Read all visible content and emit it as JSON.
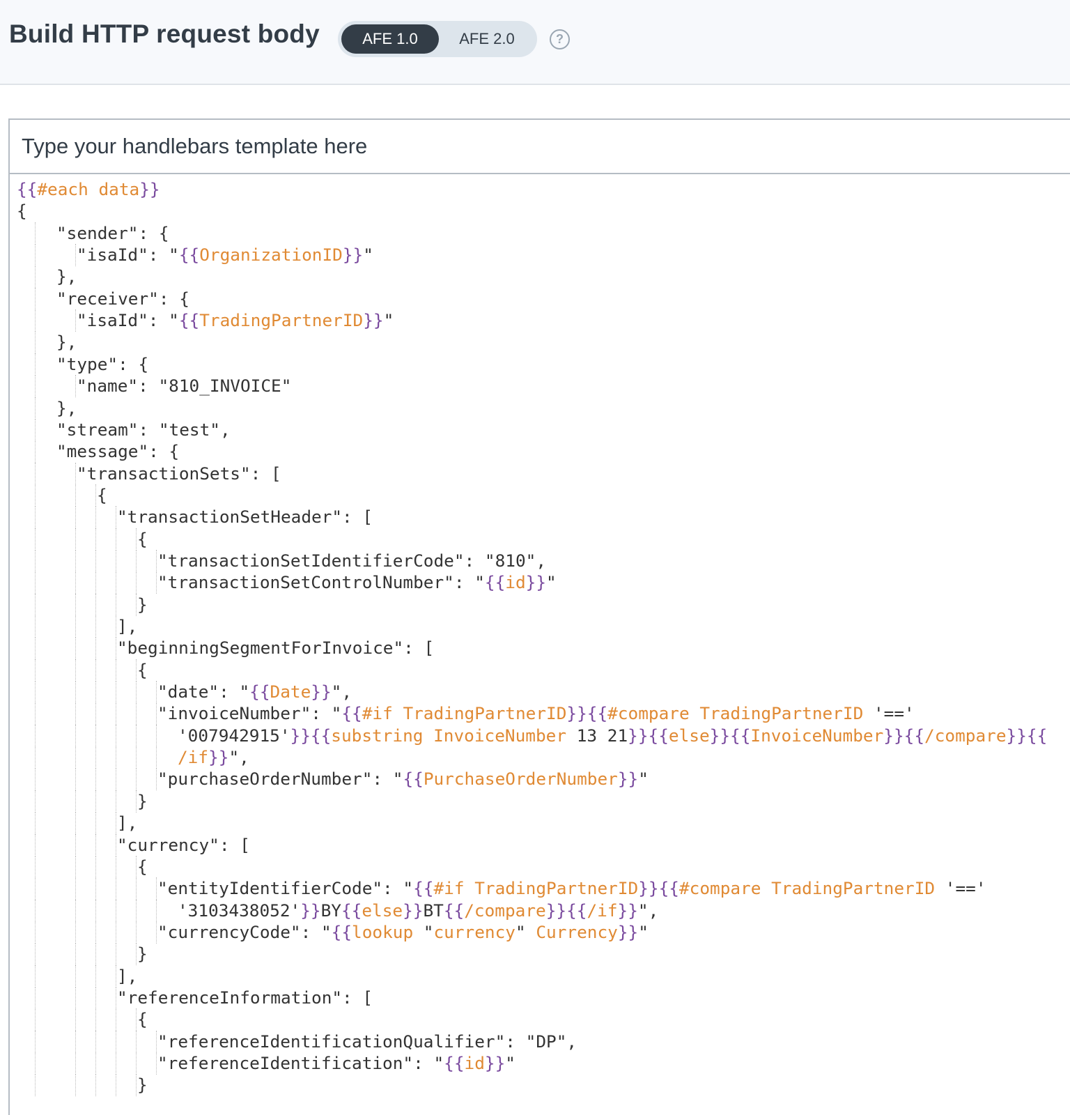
{
  "header": {
    "title": "Build HTTP request body",
    "toggle_options": [
      "AFE 1.0",
      "AFE 2.0"
    ],
    "active_option": "AFE 1.0",
    "help_icon_glyph": "?"
  },
  "editor": {
    "placeholder": "Type your handlebars template here",
    "colors": {
      "handlebars_brace": "#7a4a9e",
      "handlebars_keyword": "#e08a34",
      "text": "#333333"
    },
    "lines": [
      {
        "indent": 0,
        "tokens": [
          [
            "h",
            "{{"
          ],
          [
            "k",
            "#each data"
          ],
          [
            "h",
            "}}"
          ]
        ]
      },
      {
        "indent": 0,
        "tokens": [
          [
            "t",
            "{"
          ]
        ]
      },
      {
        "indent": 1,
        "tokens": [
          [
            "t",
            "\"sender\": {"
          ]
        ]
      },
      {
        "indent": 2,
        "tokens": [
          [
            "t",
            "\"isaId\": \""
          ],
          [
            "h",
            "{{"
          ],
          [
            "k",
            "OrganizationID"
          ],
          [
            "h",
            "}}"
          ],
          [
            "t",
            "\""
          ]
        ]
      },
      {
        "indent": 1,
        "tokens": [
          [
            "t",
            "},"
          ]
        ]
      },
      {
        "indent": 1,
        "tokens": [
          [
            "t",
            "\"receiver\": {"
          ]
        ]
      },
      {
        "indent": 2,
        "tokens": [
          [
            "t",
            "\"isaId\": \""
          ],
          [
            "h",
            "{{"
          ],
          [
            "k",
            "TradingPartnerID"
          ],
          [
            "h",
            "}}"
          ],
          [
            "t",
            "\""
          ]
        ]
      },
      {
        "indent": 1,
        "tokens": [
          [
            "t",
            "},"
          ]
        ]
      },
      {
        "indent": 1,
        "tokens": [
          [
            "t",
            "\"type\": {"
          ]
        ]
      },
      {
        "indent": 2,
        "tokens": [
          [
            "t",
            "\"name\": \"810_INVOICE\""
          ]
        ]
      },
      {
        "indent": 1,
        "tokens": [
          [
            "t",
            "},"
          ]
        ]
      },
      {
        "indent": 1,
        "tokens": [
          [
            "t",
            "\"stream\": \"test\","
          ]
        ]
      },
      {
        "indent": 1,
        "tokens": [
          [
            "t",
            "\"message\": {"
          ]
        ]
      },
      {
        "indent": 2,
        "tokens": [
          [
            "t",
            "\"transactionSets\": ["
          ]
        ]
      },
      {
        "indent": 3,
        "tokens": [
          [
            "t",
            "{"
          ]
        ]
      },
      {
        "indent": 4,
        "tokens": [
          [
            "t",
            "\"transactionSetHeader\": ["
          ]
        ]
      },
      {
        "indent": 5,
        "tokens": [
          [
            "t",
            "{"
          ]
        ]
      },
      {
        "indent": 6,
        "tokens": [
          [
            "t",
            "\"transactionSetIdentifierCode\": \"810\","
          ]
        ]
      },
      {
        "indent": 6,
        "tokens": [
          [
            "t",
            "\"transactionSetControlNumber\": \""
          ],
          [
            "h",
            "{{"
          ],
          [
            "k",
            "id"
          ],
          [
            "h",
            "}}"
          ],
          [
            "t",
            "\""
          ]
        ]
      },
      {
        "indent": 5,
        "tokens": [
          [
            "t",
            "}"
          ]
        ]
      },
      {
        "indent": 4,
        "tokens": [
          [
            "t",
            "],"
          ]
        ]
      },
      {
        "indent": 4,
        "tokens": [
          [
            "t",
            "\"beginningSegmentForInvoice\": ["
          ]
        ]
      },
      {
        "indent": 5,
        "tokens": [
          [
            "t",
            "{"
          ]
        ]
      },
      {
        "indent": 6,
        "tokens": [
          [
            "t",
            "\"date\": \""
          ],
          [
            "h",
            "{{"
          ],
          [
            "k",
            "Date"
          ],
          [
            "h",
            "}}"
          ],
          [
            "t",
            "\","
          ]
        ]
      },
      {
        "indent": 6,
        "tokens": [
          [
            "t",
            "\"invoiceNumber\": \""
          ],
          [
            "h",
            "{{"
          ],
          [
            "k",
            "#if TradingPartnerID"
          ],
          [
            "h",
            "}}{{"
          ],
          [
            "k",
            "#compare TradingPartnerID"
          ],
          [
            "t",
            " '=='"
          ]
        ]
      },
      {
        "indent": 6,
        "wrap": true,
        "tokens": [
          [
            "t",
            "'007942915'"
          ],
          [
            "h",
            "}}{{"
          ],
          [
            "k",
            "substring InvoiceNumber"
          ],
          [
            "t",
            " 13 21"
          ],
          [
            "h",
            "}}{{"
          ],
          [
            "k",
            "else"
          ],
          [
            "h",
            "}}{{"
          ],
          [
            "k",
            "InvoiceNumber"
          ],
          [
            "h",
            "}}{{"
          ],
          [
            "k",
            "/compare"
          ],
          [
            "h",
            "}}{{"
          ]
        ]
      },
      {
        "indent": 6,
        "wrap": true,
        "tokens": [
          [
            "k",
            "/if"
          ],
          [
            "h",
            "}}"
          ],
          [
            "t",
            "\","
          ]
        ]
      },
      {
        "indent": 6,
        "tokens": [
          [
            "t",
            "\"purchaseOrderNumber\": \""
          ],
          [
            "h",
            "{{"
          ],
          [
            "k",
            "PurchaseOrderNumber"
          ],
          [
            "h",
            "}}"
          ],
          [
            "t",
            "\""
          ]
        ]
      },
      {
        "indent": 5,
        "tokens": [
          [
            "t",
            "}"
          ]
        ]
      },
      {
        "indent": 4,
        "tokens": [
          [
            "t",
            "],"
          ]
        ]
      },
      {
        "indent": 4,
        "tokens": [
          [
            "t",
            "\"currency\": ["
          ]
        ]
      },
      {
        "indent": 5,
        "tokens": [
          [
            "t",
            "{"
          ]
        ]
      },
      {
        "indent": 6,
        "tokens": [
          [
            "t",
            "\"entityIdentifierCode\": \""
          ],
          [
            "h",
            "{{"
          ],
          [
            "k",
            "#if TradingPartnerID"
          ],
          [
            "h",
            "}}{{"
          ],
          [
            "k",
            "#compare TradingPartnerID"
          ],
          [
            "t",
            " '=='"
          ]
        ]
      },
      {
        "indent": 6,
        "wrap": true,
        "tokens": [
          [
            "t",
            "'3103438052'"
          ],
          [
            "h",
            "}}"
          ],
          [
            "t",
            "BY"
          ],
          [
            "h",
            "{{"
          ],
          [
            "k",
            "else"
          ],
          [
            "h",
            "}}"
          ],
          [
            "t",
            "BT"
          ],
          [
            "h",
            "{{"
          ],
          [
            "k",
            "/compare"
          ],
          [
            "h",
            "}}{{"
          ],
          [
            "k",
            "/if"
          ],
          [
            "h",
            "}}"
          ],
          [
            "t",
            "\","
          ]
        ]
      },
      {
        "indent": 6,
        "tokens": [
          [
            "t",
            "\"currencyCode\": \""
          ],
          [
            "h",
            "{{"
          ],
          [
            "k",
            "lookup"
          ],
          [
            "t",
            " \""
          ],
          [
            "k",
            "currency"
          ],
          [
            "t",
            "\" "
          ],
          [
            "k",
            "Currency"
          ],
          [
            "h",
            "}}"
          ],
          [
            "t",
            "\""
          ]
        ]
      },
      {
        "indent": 5,
        "tokens": [
          [
            "t",
            "}"
          ]
        ]
      },
      {
        "indent": 4,
        "tokens": [
          [
            "t",
            "],"
          ]
        ]
      },
      {
        "indent": 4,
        "tokens": [
          [
            "t",
            "\"referenceInformation\": ["
          ]
        ]
      },
      {
        "indent": 5,
        "tokens": [
          [
            "t",
            "{"
          ]
        ]
      },
      {
        "indent": 6,
        "tokens": [
          [
            "t",
            "\"referenceIdentificationQualifier\": \"DP\","
          ]
        ]
      },
      {
        "indent": 6,
        "tokens": [
          [
            "t",
            "\"referenceIdentification\": \""
          ],
          [
            "h",
            "{{"
          ],
          [
            "k",
            "id"
          ],
          [
            "h",
            "}}"
          ],
          [
            "t",
            "\""
          ]
        ]
      },
      {
        "indent": 5,
        "tokens": [
          [
            "t",
            "}"
          ]
        ]
      }
    ]
  }
}
